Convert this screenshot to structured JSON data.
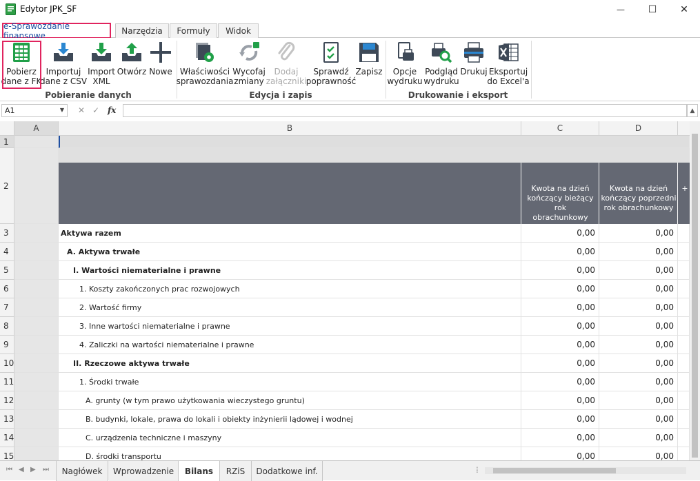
{
  "window": {
    "title": "Edytor JPK_SF",
    "controls": {
      "minimize": "—",
      "maximize": "☐",
      "close": "✕"
    }
  },
  "ribbon_tabs": [
    {
      "label": "e-Sprawozdanie finansowe",
      "active": true
    },
    {
      "label": "Narzędzia"
    },
    {
      "label": "Formuły"
    },
    {
      "label": "Widok"
    }
  ],
  "ribbon": {
    "buttons": [
      {
        "label": "Pobierz",
        "label2": "dane z FK",
        "icon": "grid-table-icon"
      },
      {
        "label": "Importuj",
        "label2": "dane z CSV",
        "icon": "import-tray-icon"
      },
      {
        "label": "Import",
        "label2": "XML",
        "icon": "import-tray-green-icon"
      },
      {
        "label": "Otwórz",
        "label2": "",
        "icon": "open-tray-icon"
      },
      {
        "label": "Nowe",
        "label2": "",
        "icon": "plus-icon"
      },
      {
        "label": "Właściwości",
        "label2": "sprawozdania",
        "icon": "properties-gear-icon"
      },
      {
        "label": "Wycofaj",
        "label2": "zmiany",
        "icon": "revert-changes-icon"
      },
      {
        "label": "Dodaj",
        "label2": "załączniki",
        "icon": "paperclip-icon",
        "disabled": true
      },
      {
        "label": "Sprawdź",
        "label2": "poprawność",
        "icon": "check-document-icon"
      },
      {
        "label": "Zapisz",
        "label2": "",
        "icon": "save-disk-icon"
      },
      {
        "label": "Opcje",
        "label2": "wydruku",
        "icon": "print-options-icon"
      },
      {
        "label": "Podgląd",
        "label2": "wydruku",
        "icon": "print-preview-icon"
      },
      {
        "label": "Drukuj",
        "label2": "",
        "icon": "printer-icon"
      },
      {
        "label": "Eksportuj",
        "label2": "do Excel'a",
        "icon": "excel-export-icon"
      }
    ],
    "groups": {
      "g1": "Pobieranie danych",
      "g2": "Edycja i zapis",
      "g3": "Drukowanie i eksport"
    }
  },
  "formula_bar": {
    "name_box": "A1",
    "cancel_glyph": "✕",
    "accept_glyph": "✓",
    "fx_glyph": "fx",
    "value": ""
  },
  "sheet": {
    "columns": [
      "A",
      "B",
      "C",
      "D"
    ],
    "header_row": {
      "c_line1": "Kwota na dzień",
      "c_line2": "kończący bieżący rok",
      "c_line3": "obrachunkowy",
      "d_line1": "Kwota na dzień",
      "d_line2": "kończący poprzedni",
      "d_line3": "rok obrachunkowy",
      "e_partial": "+"
    },
    "rows": [
      {
        "n": "1",
        "label": "",
        "c": "",
        "d": ""
      },
      {
        "n": "2",
        "label": "",
        "c": "",
        "d": ""
      },
      {
        "n": "3",
        "label": "Aktywa razem",
        "c": "0,00",
        "d": "0,00",
        "bold": true,
        "indent": 0
      },
      {
        "n": "4",
        "label": "A. Aktywa trwałe",
        "c": "0,00",
        "d": "0,00",
        "bold": true,
        "indent": 1
      },
      {
        "n": "5",
        "label": "I. Wartości niematerialne i prawne",
        "c": "0,00",
        "d": "0,00",
        "bold": true,
        "indent": 2
      },
      {
        "n": "6",
        "label": "1. Koszty zakończonych prac rozwojowych",
        "c": "0,00",
        "d": "0,00",
        "indent": 3
      },
      {
        "n": "7",
        "label": "2. Wartość firmy",
        "c": "0,00",
        "d": "0,00",
        "indent": 3
      },
      {
        "n": "8",
        "label": "3. Inne wartości niematerialne i prawne",
        "c": "0,00",
        "d": "0,00",
        "indent": 3
      },
      {
        "n": "9",
        "label": "4. Zaliczki na wartości niematerialne i prawne",
        "c": "0,00",
        "d": "0,00",
        "indent": 3
      },
      {
        "n": "10",
        "label": "II. Rzeczowe aktywa trwałe",
        "c": "0,00",
        "d": "0,00",
        "bold": true,
        "indent": 2
      },
      {
        "n": "11",
        "label": "1. Środki trwałe",
        "c": "0,00",
        "d": "0,00",
        "indent": 3
      },
      {
        "n": "12",
        "label": "A. grunty (w tym prawo użytkowania wieczystego gruntu)",
        "c": "0,00",
        "d": "0,00",
        "indent": 4
      },
      {
        "n": "13",
        "label": "B. budynki, lokale, prawa do lokali i obiekty inżynierii lądowej i wodnej",
        "c": "0,00",
        "d": "0,00",
        "indent": 4
      },
      {
        "n": "14",
        "label": "C. urządzenia techniczne i maszyny",
        "c": "0,00",
        "d": "0,00",
        "indent": 4
      },
      {
        "n": "15",
        "label": "D. środki transportu",
        "c": "0,00",
        "d": "0,00",
        "indent": 4
      }
    ]
  },
  "sheet_tabs": [
    {
      "label": "Nagłówek"
    },
    {
      "label": "Wprowadzenie"
    },
    {
      "label": "Bilans",
      "active": true
    },
    {
      "label": "RZiS"
    },
    {
      "label": "Dodatkowe inf."
    }
  ],
  "sheet_nav": {
    "first": "⏮",
    "prev": "◀",
    "next": "▶",
    "last": "⏭"
  },
  "colors": {
    "accent": "#1f4fa1",
    "highlight": "#e0245e",
    "header_band": "#646873",
    "green": "#1e9e3a"
  }
}
